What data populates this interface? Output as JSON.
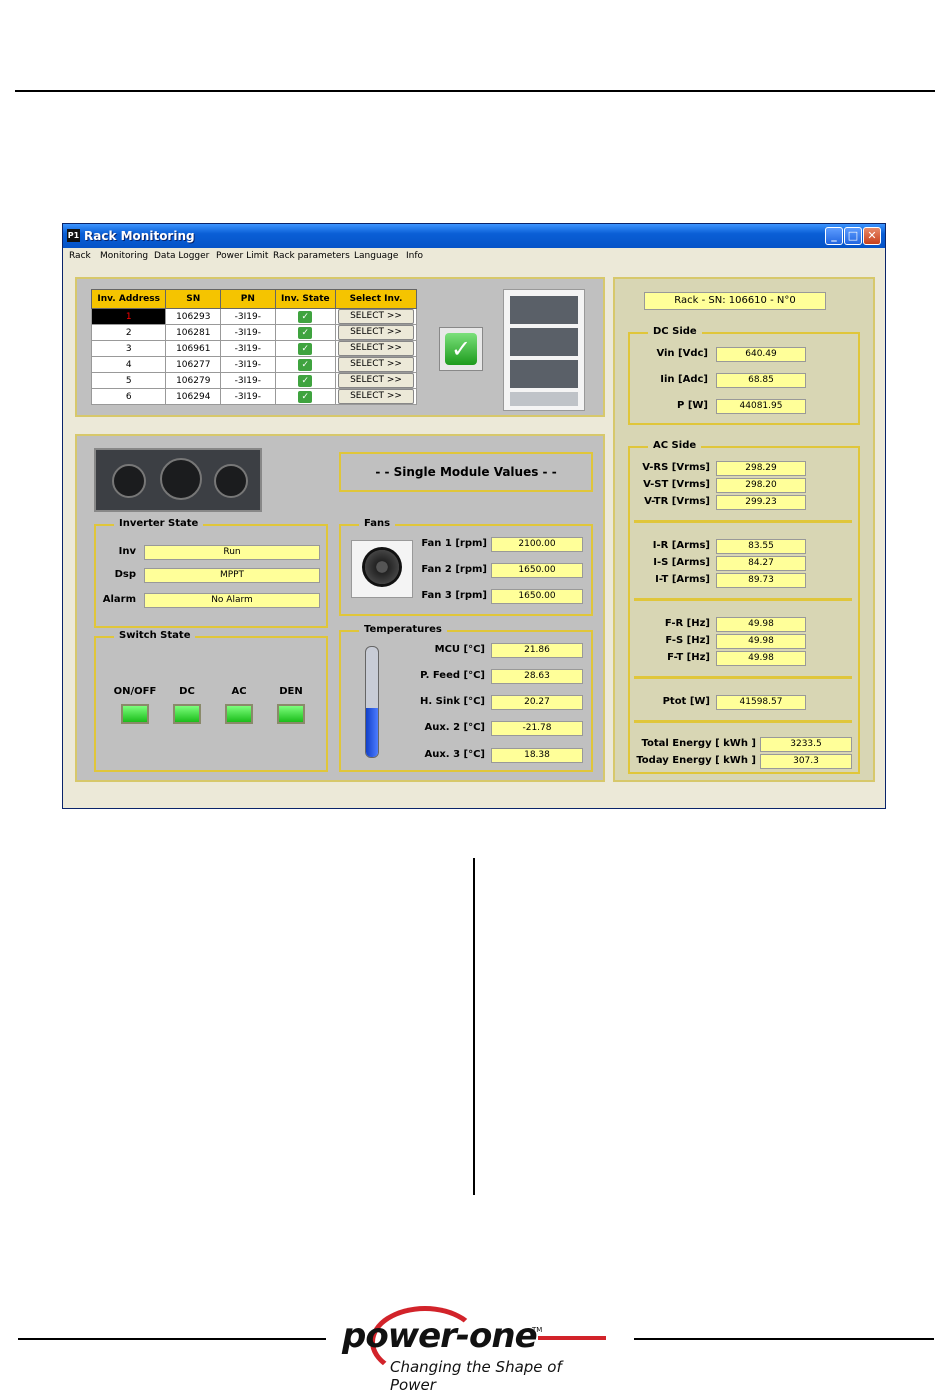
{
  "window": {
    "title": "Rack Monitoring",
    "app_icon": "P1"
  },
  "menu": [
    "Rack",
    "Monitoring",
    "Data Logger",
    "Power Limit",
    "Rack parameters",
    "Language",
    "Info"
  ],
  "inverter_table": {
    "headers": [
      "Inv. Address",
      "SN",
      "PN",
      "Inv. State",
      "Select Inv."
    ],
    "rows": [
      {
        "address": "1",
        "sn": "106293",
        "pn": "-3I19-",
        "select": "SELECT >>"
      },
      {
        "address": "2",
        "sn": "106281",
        "pn": "-3I19-",
        "select": "SELECT >>"
      },
      {
        "address": "3",
        "sn": "106961",
        "pn": "-3I19-",
        "select": "SELECT >>"
      },
      {
        "address": "4",
        "sn": "106277",
        "pn": "-3I19-",
        "select": "SELECT >>"
      },
      {
        "address": "5",
        "sn": "106279",
        "pn": "-3I19-",
        "select": "SELECT >>"
      },
      {
        "address": "6",
        "sn": "106294",
        "pn": "-3I19-",
        "select": "SELECT >>"
      }
    ]
  },
  "single_module_title": "- - Single Module Values - -",
  "inverter_state": {
    "title": "Inverter State",
    "items": [
      {
        "label": "Inv",
        "value": "Run"
      },
      {
        "label": "Dsp",
        "value": "MPPT"
      },
      {
        "label": "Alarm",
        "value": "No Alarm"
      }
    ]
  },
  "fans": {
    "title": "Fans",
    "items": [
      {
        "label": "Fan 1 [rpm]",
        "value": "2100.00"
      },
      {
        "label": "Fan 2 [rpm]",
        "value": "1650.00"
      },
      {
        "label": "Fan 3 [rpm]",
        "value": "1650.00"
      }
    ]
  },
  "switch_state": {
    "title": "Switch State",
    "items": [
      "ON/OFF",
      "DC",
      "AC",
      "DEN"
    ]
  },
  "temperatures": {
    "title": "Temperatures",
    "thermometer_level": 0.45,
    "items": [
      {
        "label": "MCU [°C]",
        "value": "21.86"
      },
      {
        "label": "P. Feed [°C]",
        "value": "28.63"
      },
      {
        "label": "H. Sink [°C]",
        "value": "20.27"
      },
      {
        "label": "Aux. 2 [°C]",
        "value": "-21.78"
      },
      {
        "label": "Aux. 3 [°C]",
        "value": "18.38"
      }
    ]
  },
  "rack_sn": "Rack - SN: 106610 - N°0",
  "dc_side": {
    "title": "DC Side",
    "items": [
      {
        "label": "Vin [Vdc]",
        "value": "640.49"
      },
      {
        "label": "Iin [Adc]",
        "value": "68.85"
      },
      {
        "label": "P [W]",
        "value": "44081.95"
      }
    ]
  },
  "ac_side": {
    "title": "AC Side",
    "voltages": [
      {
        "label": "V-RS [Vrms]",
        "value": "298.29"
      },
      {
        "label": "V-ST [Vrms]",
        "value": "298.20"
      },
      {
        "label": "V-TR [Vrms]",
        "value": "299.23"
      }
    ],
    "currents": [
      {
        "label": "I-R [Arms]",
        "value": "83.55"
      },
      {
        "label": "I-S [Arms]",
        "value": "84.27"
      },
      {
        "label": "I-T [Arms]",
        "value": "89.73"
      }
    ],
    "frequencies": [
      {
        "label": "F-R [Hz]",
        "value": "49.98"
      },
      {
        "label": "F-S [Hz]",
        "value": "49.98"
      },
      {
        "label": "F-T [Hz]",
        "value": "49.98"
      }
    ],
    "ptot": {
      "label": "Ptot [W]",
      "value": "41598.57"
    },
    "total_energy": {
      "label": "Total Energy [ kWh ]",
      "value": "3233.5"
    },
    "today_energy": {
      "label": "Today Energy [ kWh ]",
      "value": "307.3"
    }
  },
  "footer": {
    "brand": "power-one",
    "trademark": "TM",
    "tagline": "Changing the Shape of Power"
  },
  "colors": {
    "highlight": "#ffff99",
    "group_border": "#e0c63a",
    "table_header": "#f5c400"
  }
}
